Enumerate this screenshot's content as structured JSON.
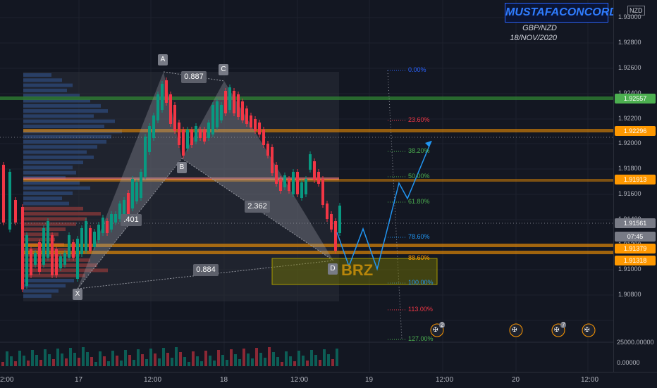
{
  "watermark": "MUSTAFACONCORD",
  "currency_badge": "NZD",
  "symbol": "GBP/NZD",
  "date": "18/NOV/2020",
  "price_axis": {
    "ticks": [
      "1.93000",
      "1.92800",
      "1.92600",
      "1.92400",
      "1.92200",
      "1.92000",
      "1.91800",
      "1.91600",
      "1.91400",
      "1.91200",
      "1.91000",
      "1.90800"
    ],
    "volume_ticks": [
      "25000.00000",
      "0.00000"
    ]
  },
  "price_tags": [
    {
      "label": "1.92557",
      "color": "#4caf50"
    },
    {
      "label": "1.92296",
      "color": "#ff9800"
    },
    {
      "label": "1.91913",
      "color": "#ff9800"
    },
    {
      "label": "1.91561",
      "color": "#787b86"
    },
    {
      "label": "07:45",
      "color": "#787b86"
    },
    {
      "label": "1.91379",
      "color": "#ff9800"
    },
    {
      "label": "1.91318",
      "color": "#ff9800"
    }
  ],
  "time_axis": [
    "2:00",
    "17",
    "12:00",
    "18",
    "12:00",
    "19",
    "12:00",
    "20",
    "12:00"
  ],
  "pattern": {
    "points": [
      "X",
      "A",
      "B",
      "C",
      "D"
    ],
    "ratios": {
      "xa_b": "0.887",
      "ab_c": ".401",
      "bc_d": "2.362",
      "xa_d": "0.884"
    },
    "label": "BRZ"
  },
  "fib_levels": [
    {
      "label": "0.00%",
      "color": "#2962ff"
    },
    {
      "label": "23.60%",
      "color": "#f23645"
    },
    {
      "label": "38.20%",
      "color": "#4caf50"
    },
    {
      "label": "50.00%",
      "color": "#4caf50"
    },
    {
      "label": "61.80%",
      "color": "#4caf50"
    },
    {
      "label": "78.60%",
      "color": "#2196f3"
    },
    {
      "label": "88.60%",
      "color": "#ff9800"
    },
    {
      "label": "100.00%",
      "color": "#2196f3"
    },
    {
      "label": "113.00%",
      "color": "#f23645"
    },
    {
      "label": "127.00%",
      "color": "#4caf50"
    }
  ],
  "events": [
    {
      "icon": "uk-flag-icon",
      "count": "2"
    },
    {
      "icon": "uk-flag-icon",
      "count": ""
    },
    {
      "icon": "uk-flag-icon",
      "count": "7"
    },
    {
      "icon": "uk-flag-icon",
      "count": ""
    }
  ],
  "colors": {
    "up": "#089981",
    "down": "#f23645",
    "orange": "#ff9800",
    "green_line": "#4caf50",
    "pink": "#e57373"
  }
}
